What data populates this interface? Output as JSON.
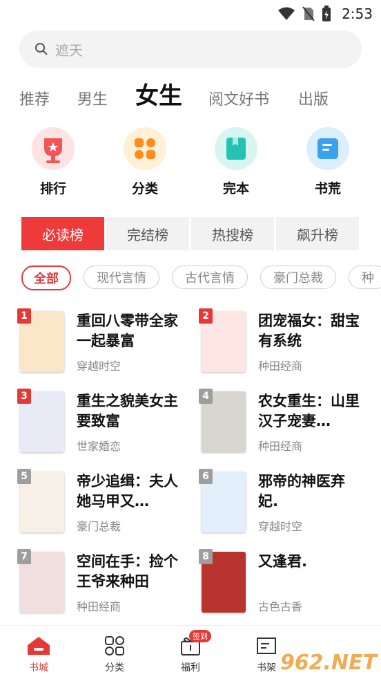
{
  "status": {
    "time": "2:53"
  },
  "search": {
    "placeholder": "遮天"
  },
  "tabs": [
    "推荐",
    "男生",
    "女生",
    "阅文好书",
    "出版"
  ],
  "quick": [
    {
      "label": "排行",
      "icon": "trophy-icon",
      "color": "#f25555"
    },
    {
      "label": "分类",
      "icon": "grid-icon",
      "color": "#ff8a1e"
    },
    {
      "label": "完本",
      "icon": "book-icon",
      "color": "#25c2b4"
    },
    {
      "label": "书荒",
      "icon": "list-book-icon",
      "color": "#3aa0f0"
    }
  ],
  "rank_tabs": [
    "必读榜",
    "完结榜",
    "热搜榜",
    "飙升榜"
  ],
  "chips": [
    "全部",
    "现代言情",
    "古代言情",
    "豪门总裁",
    "种"
  ],
  "books": [
    {
      "rank": "1",
      "title": "重回八零带全家一起暴富",
      "category": "穿越时空",
      "rank_color": "#e53935",
      "cover": "#fbe7c8"
    },
    {
      "rank": "2",
      "title": "团宠福女：甜宝有系统",
      "category": "种田经商",
      "rank_color": "#e53935",
      "cover": "#fde6e4"
    },
    {
      "rank": "3",
      "title": "重生之貌美女主要致富",
      "category": "世家婚恋",
      "rank_color": "#e53935",
      "cover": "#e8eaf6"
    },
    {
      "rank": "4",
      "title": "农女重生：山里汉子宠妻…",
      "category": "种田经商",
      "rank_color": "#9e9e9e",
      "cover": "#d9d5cf"
    },
    {
      "rank": "5",
      "title": "帝少追缉：夫人她马甲又…",
      "category": "豪门总裁",
      "rank_color": "#9e9e9e",
      "cover": "#f6f0e6"
    },
    {
      "rank": "6",
      "title": "邪帝的神医弃妃.",
      "category": "穿越时空",
      "rank_color": "#9e9e9e",
      "cover": "#e3f0fb"
    },
    {
      "rank": "7",
      "title": "空间在手：捡个王爷来种田",
      "category": "种田经商",
      "rank_color": "#9e9e9e",
      "cover": "#f1dede"
    },
    {
      "rank": "8",
      "title": "又逢君.",
      "category": "古色古香",
      "rank_color": "#9e9e9e",
      "cover": "#b8322e"
    }
  ],
  "nav": [
    {
      "label": "书城",
      "icon": "bookstore-icon"
    },
    {
      "label": "分类",
      "icon": "category-icon"
    },
    {
      "label": "福利",
      "icon": "gift-icon",
      "badge": "签到"
    },
    {
      "label": "书架",
      "icon": "bookshelf-icon"
    }
  ],
  "watermark": "962.NET"
}
